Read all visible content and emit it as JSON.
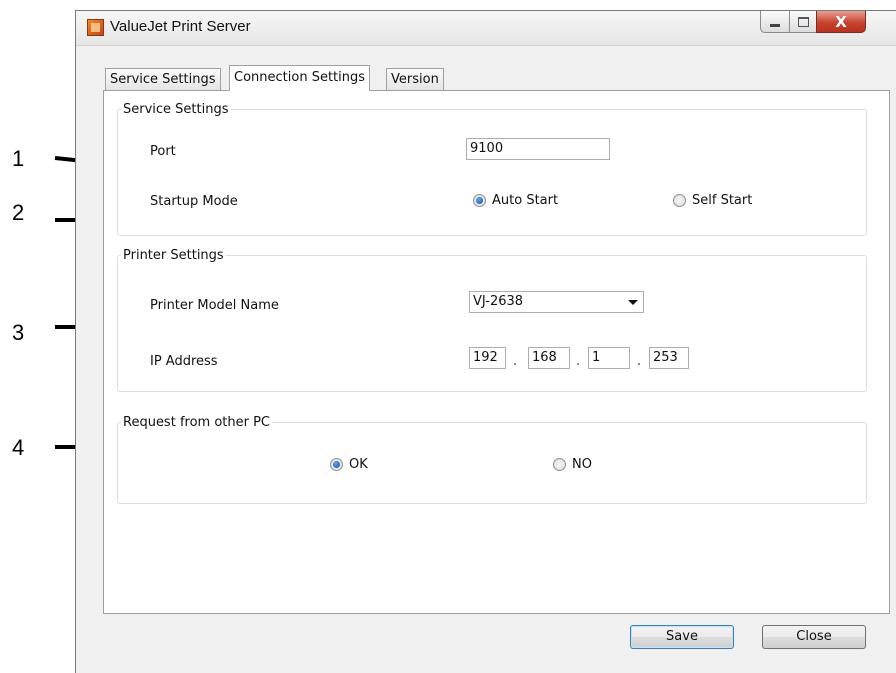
{
  "callouts": [
    "1",
    "2",
    "3",
    "4"
  ],
  "window": {
    "title": "ValueJet Print Server",
    "close_glyph": "X"
  },
  "tabs": [
    {
      "label": "Service Settings",
      "active": false
    },
    {
      "label": "Connection Settings",
      "active": true
    },
    {
      "label": "Version",
      "active": false
    }
  ],
  "service_settings": {
    "legend": "Service Settings",
    "port_label": "Port",
    "port_value": "9100",
    "startup_label": "Startup Mode",
    "startup_options": [
      "Auto Start",
      "Self Start"
    ],
    "startup_selected": "Auto Start"
  },
  "printer_settings": {
    "legend": "Printer Settings",
    "model_label": "Printer Model Name",
    "model_value": "VJ-2638",
    "ip_label": "IP Address",
    "ip_octets": [
      "192",
      "168",
      "1",
      "253"
    ]
  },
  "request_other_pc": {
    "legend": "Request from other PC",
    "options": [
      "OK",
      "NO"
    ],
    "selected": "OK"
  },
  "buttons": {
    "save": "Save",
    "close": "Close"
  },
  "colors": {
    "radio_selected": "#0c4fa8",
    "close_button": "#c7432f"
  }
}
